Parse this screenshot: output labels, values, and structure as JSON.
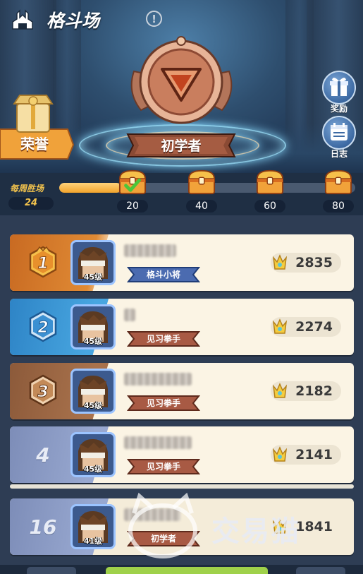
{
  "header": {
    "title": "格斗场",
    "info_icon": "!",
    "current_rank": "初学者",
    "honor_label": "荣誉",
    "reward_label": "奖励",
    "log_label": "日志"
  },
  "weekly": {
    "label": "每周胜场",
    "value": "24",
    "progress_fraction": 0.21,
    "milestones": [
      {
        "value": "20",
        "claimed": true
      },
      {
        "value": "40",
        "claimed": false
      },
      {
        "value": "60",
        "claimed": false
      },
      {
        "value": "80",
        "claimed": false
      }
    ]
  },
  "ranking": [
    {
      "rank": "1",
      "level": "45级",
      "title": "格斗小将",
      "score": "2835"
    },
    {
      "rank": "2",
      "level": "45级",
      "title": "见习拳手",
      "score": "2274"
    },
    {
      "rank": "3",
      "level": "45级",
      "title": "见习拳手",
      "score": "2182"
    },
    {
      "rank": "4",
      "level": "45级",
      "title": "见习拳手",
      "score": "2141"
    }
  ],
  "self": {
    "rank": "16",
    "level": "41级",
    "title": "初学者",
    "score": "1841"
  },
  "watermark": "交易猫",
  "colors": {
    "gold": "#f3c34d",
    "rank1": "#e08a34",
    "rank2": "#48a6e0",
    "rank3": "#a9724c",
    "rank_other": "#98a8d0"
  }
}
